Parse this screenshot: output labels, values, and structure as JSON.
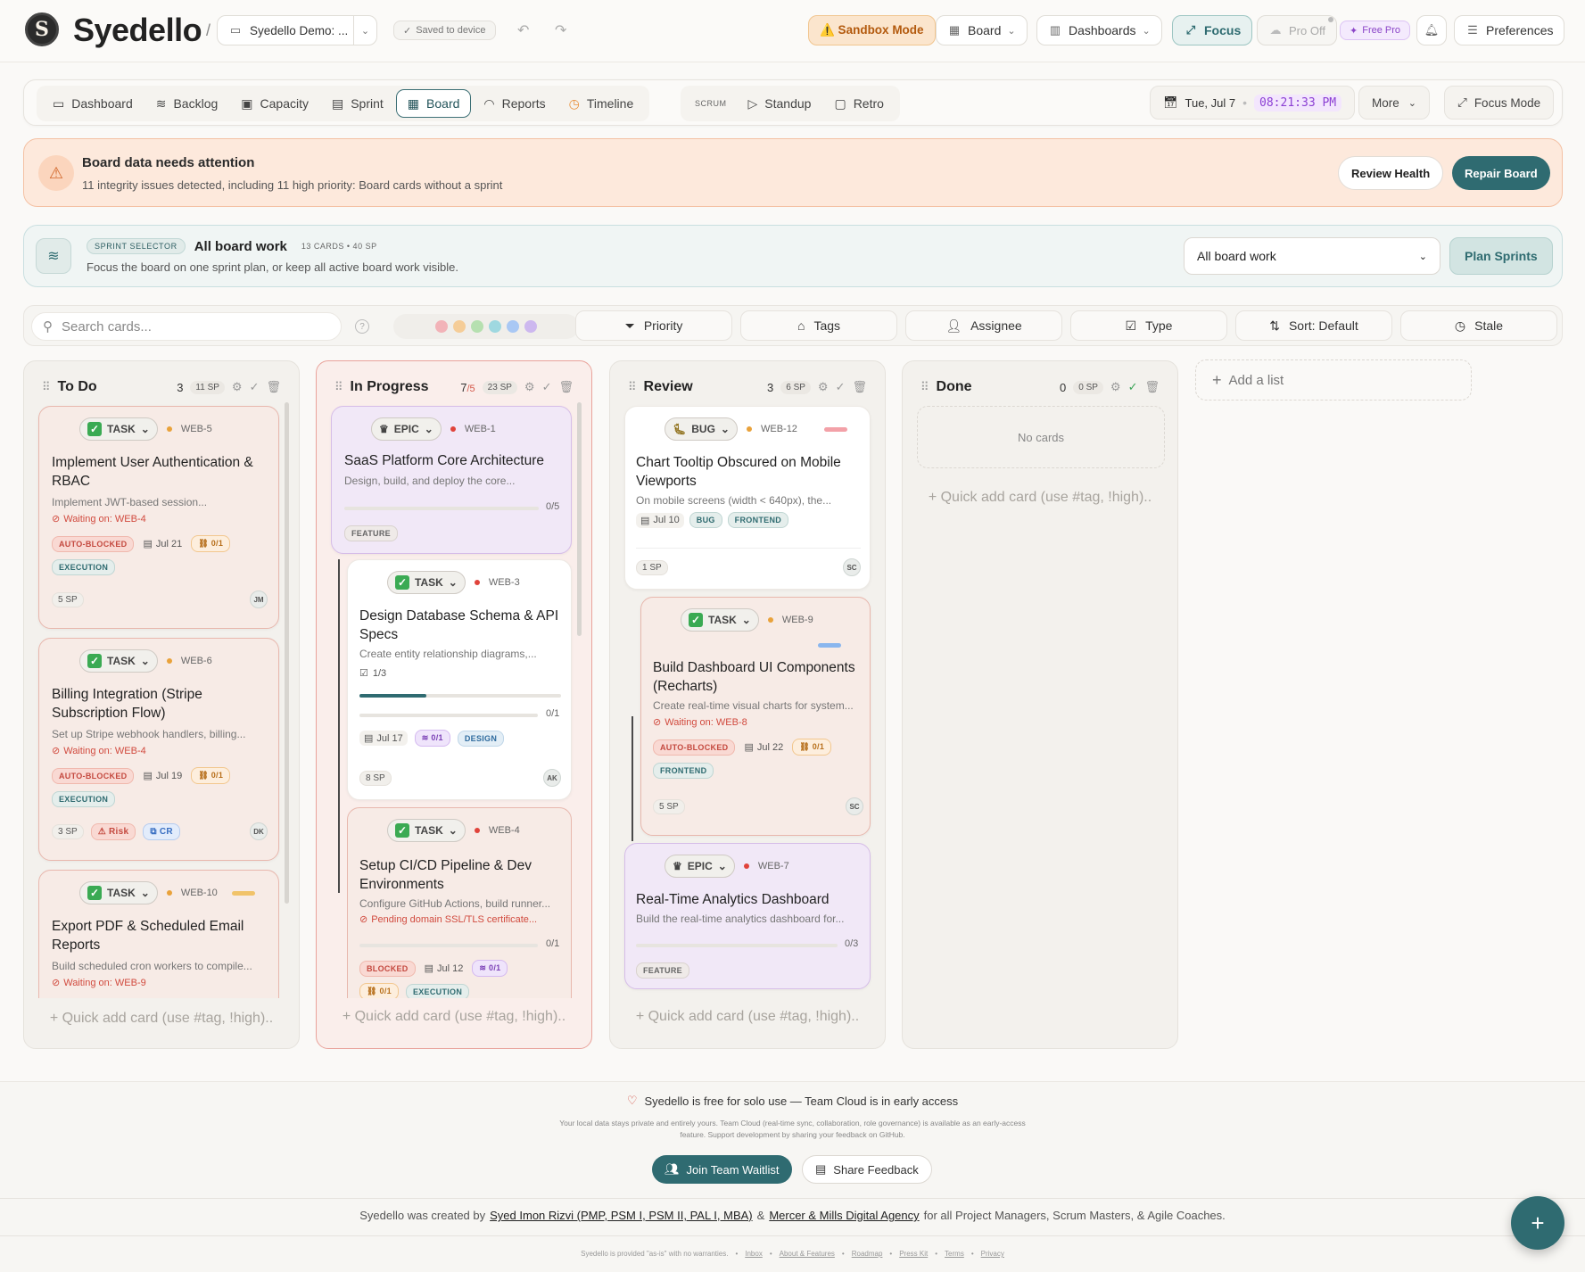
{
  "header": {
    "logo_letter": "S",
    "brand": "Syedello",
    "workspace": "Syedello Demo: ...",
    "saved": "Saved to device",
    "sandbox": "⚠️ Sandbox Mode",
    "board": "Board",
    "dashboards": "Dashboards",
    "focus": "Focus",
    "pro_off": "Pro Off",
    "free_pro": "Free Pro",
    "preferences": "Preferences"
  },
  "nav": {
    "items": [
      "Dashboard",
      "Backlog",
      "Capacity",
      "Sprint",
      "Board",
      "Reports",
      "Timeline"
    ],
    "scrum": "SCRUM",
    "scrum_items": [
      "Standup",
      "Retro"
    ],
    "date": "Tue, Jul 7",
    "time": "08:21:33 PM",
    "more": "More",
    "focus_mode": "Focus Mode"
  },
  "alert": {
    "title": "Board data needs attention",
    "text": "11 integrity issues detected, including 11 high priority: Board cards without a sprint",
    "review": "Review Health",
    "repair": "Repair Board"
  },
  "sprint": {
    "tag": "SPRINT SELECTOR",
    "title": "All board work",
    "meta": "13 CARDS • 40 SP",
    "desc": "Focus the board on one sprint plan, or keep all active board work visible.",
    "selected": "All board work",
    "plan": "Plan Sprints"
  },
  "filter": {
    "placeholder": "Search cards...",
    "dot_colors": [
      "#f2b3b8",
      "#f5cd98",
      "#b6e0b0",
      "#9fd8e0",
      "#a9c8f4",
      "#cdb8ef"
    ],
    "buttons": [
      "Priority",
      "Tags",
      "Assignee",
      "Type",
      "Sort: Default",
      "Stale"
    ]
  },
  "columns": {
    "todo": {
      "title": "To Do",
      "count": "3",
      "sp": "11 SP"
    },
    "progress": {
      "title": "In Progress",
      "count": "7",
      "limit": "/5",
      "sp": "23 SP"
    },
    "review": {
      "title": "Review",
      "count": "3",
      "sp": "6 SP"
    },
    "done": {
      "title": "Done",
      "count": "0",
      "sp": "0 SP",
      "empty": "No cards"
    },
    "quick_add": "+ Quick add card (use #tag, !high).."
  },
  "cards": {
    "web5": {
      "type": "TASK",
      "key": "WEB-5",
      "title": "Implement User Authentication & RBAC",
      "desc": "Implement JWT-based session...",
      "wait": "Waiting on: WEB-4",
      "status": "AUTO-BLOCKED",
      "date": "Jul 21",
      "link": "0/1",
      "tag": "EXECUTION",
      "sp": "5 SP",
      "av": "JM"
    },
    "web6": {
      "type": "TASK",
      "key": "WEB-6",
      "title": "Billing Integration (Stripe Subscription Flow)",
      "desc": "Set up Stripe webhook handlers, billing...",
      "wait": "Waiting on: WEB-4",
      "status": "AUTO-BLOCKED",
      "date": "Jul 19",
      "link": "0/1",
      "tag": "EXECUTION",
      "sp": "3 SP",
      "risk": "Risk",
      "cr": "CR",
      "av": "DK"
    },
    "web10": {
      "type": "TASK",
      "key": "WEB-10",
      "title": "Export PDF & Scheduled Email Reports",
      "desc": "Build scheduled cron workers to compile...",
      "wait": "Waiting on: WEB-9"
    },
    "web1": {
      "type": "EPIC",
      "key": "WEB-1",
      "title": "SaaS Platform Core Architecture",
      "desc": "Design, build, and deploy the core...",
      "progress": "0/5",
      "tag": "FEATURE"
    },
    "web3": {
      "type": "TASK",
      "key": "WEB-3",
      "title": "Design Database Schema & API Specs",
      "desc": "Create entity relationship diagrams,...",
      "checklist": "1/3",
      "checklist_fraction": 0.33,
      "progress": "0/1",
      "date": "Jul 17",
      "link": "0/1",
      "tag": "DESIGN",
      "sp": "8 SP",
      "av": "AK"
    },
    "web4": {
      "type": "TASK",
      "key": "WEB-4",
      "title": "Setup CI/CD Pipeline & Dev Environments",
      "desc": "Configure GitHub Actions, build runner...",
      "wait": "Pending domain SSL/TLS certificate...",
      "progress": "0/1",
      "status": "BLOCKED",
      "date": "Jul 12",
      "link": "0/1",
      "link2": "0/1",
      "tag": "EXECUTION"
    },
    "web12": {
      "type": "BUG",
      "key": "WEB-12",
      "title": "Chart Tooltip Obscured on Mobile Viewports",
      "desc": "On mobile screens (width < 640px), the...",
      "date": "Jul 10",
      "tag1": "BUG",
      "tag2": "FRONTEND",
      "sp": "1 SP",
      "av": "SC"
    },
    "web9": {
      "type": "TASK",
      "key": "WEB-9",
      "title": "Build Dashboard UI Components (Recharts)",
      "desc": "Create real-time visual charts for system...",
      "wait": "Waiting on: WEB-8",
      "status": "AUTO-BLOCKED",
      "date": "Jul 22",
      "link": "0/1",
      "tag": "FRONTEND",
      "sp": "5 SP",
      "av": "SC"
    },
    "web7": {
      "type": "EPIC",
      "key": "WEB-7",
      "title": "Real-Time Analytics Dashboard",
      "desc": "Build the real-time analytics dashboard for...",
      "progress": "0/3",
      "tag": "FEATURE"
    }
  },
  "add_list": "Add a list",
  "footer": {
    "tagline": "Syedello is free for solo use — Team Cloud is in early access",
    "small": "Your local data stays private and entirely yours. Team Cloud (real-time sync, collaboration, role governance) is available as an early-access feature. Support development by sharing your feedback on GitHub.",
    "join": "Join Team Waitlist",
    "share": "Share Feedback",
    "credit_pre": "Syedello was created by",
    "credit_name": "Syed Imon Rizvi (PMP, PSM I, PSM II, PAL I, MBA)",
    "credit_amp": "&",
    "credit_agency": "Mercer & Mills Digital Agency",
    "credit_post": "for all Project Managers, Scrum Masters, & Agile Coaches.",
    "disclaimer": "Syedello is provided \"as-is\" with no warranties.",
    "links": [
      "Inbox",
      "About & Features",
      "Roadmap",
      "Press Kit",
      "Terms",
      "Privacy"
    ]
  },
  "fab": "+"
}
